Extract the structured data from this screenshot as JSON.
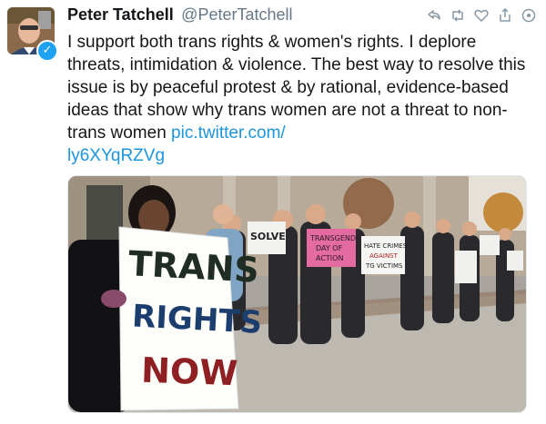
{
  "tweet": {
    "display_name": "Peter Tatchell",
    "handle": "@PeterTatchell",
    "verified_icon": "verified-badge-icon",
    "text": "I support both trans rights & women's rights. I deplore threats, intimidation & violence. The best way to resolve this issue is by peaceful protest & by rational, evidence-based ideas that show why trans women are not a threat to non-trans women ",
    "link_line1": "pic.twitter.com/",
    "link_line2": "ly6XYqRZVg",
    "actions": [
      "reply-icon",
      "retweet-icon",
      "like-icon",
      "share-icon",
      "more-icon"
    ]
  },
  "photo": {
    "signs": {
      "main_line1": "TRANS",
      "main_line2": "RIGHTS",
      "main_line3": "NOW",
      "partial_sign": "SOLVE",
      "pink_sign_line1": "TRANSGENDER",
      "pink_sign_line2": "DAY OF",
      "pink_sign_line3": "ACTION",
      "white_sign_line1": "HATE CRIMES",
      "white_sign_line2": "AGAINST",
      "white_sign_line3": "TG VICTIMS"
    }
  },
  "colors": {
    "link": "#1b95e0",
    "verified": "#1da1f2",
    "icon": "#8899a6"
  }
}
